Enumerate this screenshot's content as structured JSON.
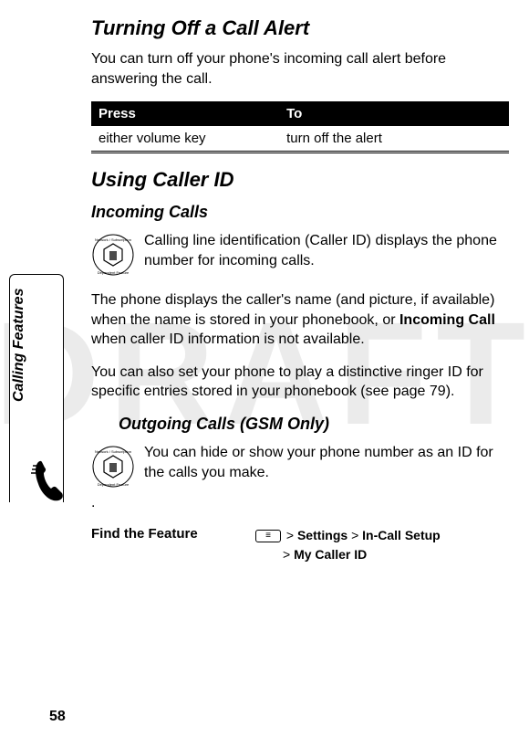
{
  "watermark": "DRAFT",
  "side_label": "Calling Features",
  "section1": {
    "title": "Turning Off a Call Alert",
    "intro": "You can turn off your phone's incoming call alert before answering the call.",
    "table": {
      "head": {
        "press": "Press",
        "to": "To"
      },
      "row": {
        "press": "either volume key",
        "to": "turn off the alert"
      }
    }
  },
  "section2": {
    "title": "Using Caller ID",
    "sub1": "Incoming Calls",
    "p1": "Calling line identification (Caller ID) displays the phone number for incoming calls.",
    "p2a": "The phone displays the caller's name (and picture, if available) when the name is stored in your phonebook, or ",
    "p2_bold": "Incoming Call",
    "p2b": " when caller ID information is not available.",
    "p3": "You can also set your phone to play a distinctive ringer ID for specific entries stored in your phonebook (see page 79).",
    "sub2": "Outgoing Calls (GSM Only)",
    "p4": "You can hide or show your phone number as an ID for the calls you make.",
    "dot": "."
  },
  "feature": {
    "label": "Find the Feature",
    "path1a": " > ",
    "path1_settings": "Settings",
    "path1b": " > ",
    "path1_incall": "In-Call Setup",
    "path2a": "> ",
    "path2_caller": "My Caller ID"
  },
  "page": "58",
  "icons": {
    "badge": "network-subscription-badge",
    "phone": "phone-handset-icon"
  }
}
